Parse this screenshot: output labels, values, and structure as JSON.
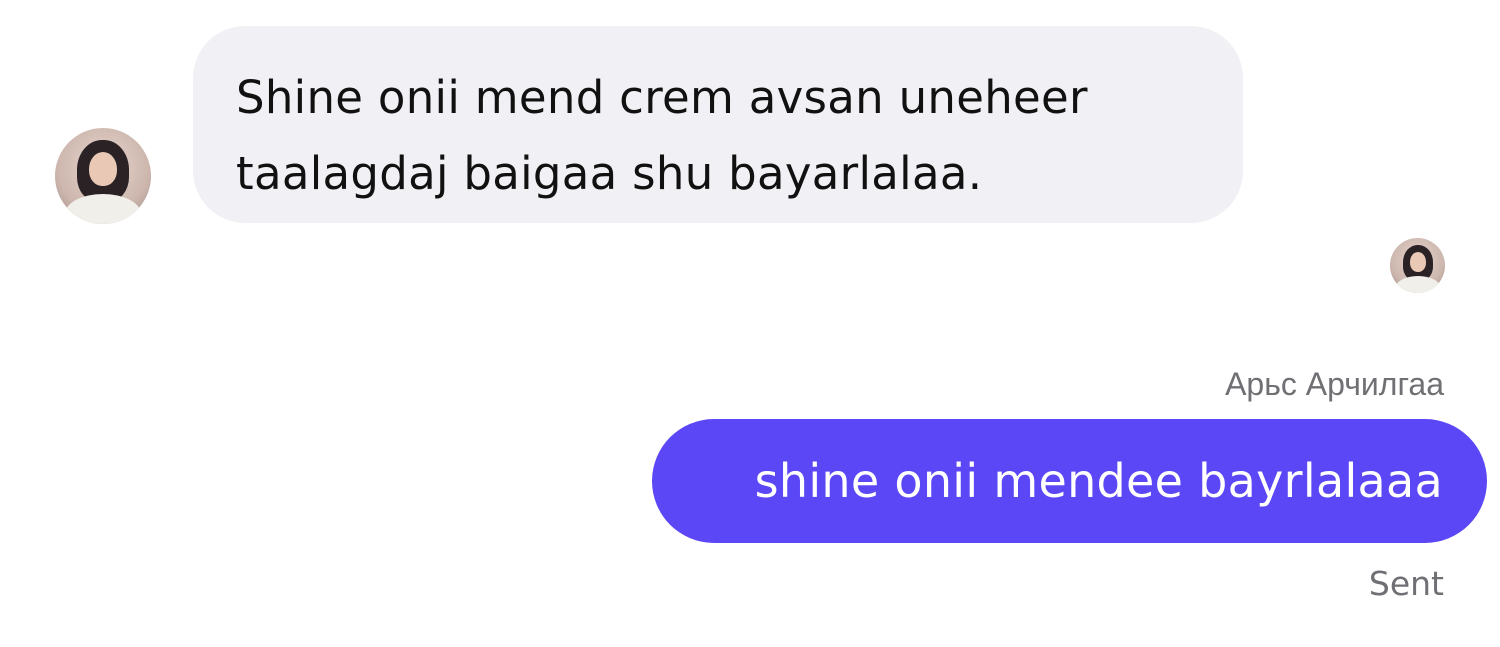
{
  "conversation": {
    "incoming": {
      "avatar_icon": "contact-avatar",
      "text": "Shine onii mend crem avsan uneheer taalagdaj baigaa shu bayarlalaa."
    },
    "read_receipt": {
      "avatar_icon": "read-receipt-avatar"
    },
    "outgoing": {
      "sender_name": "Арьс Арчилгаа",
      "text": "shine onii mendee bayrlalaaa",
      "status": "Sent"
    }
  },
  "colors": {
    "incoming_bubble": "#f1f1f5",
    "outgoing_bubble": "#5b47f5",
    "meta_text": "#6f6f74"
  }
}
